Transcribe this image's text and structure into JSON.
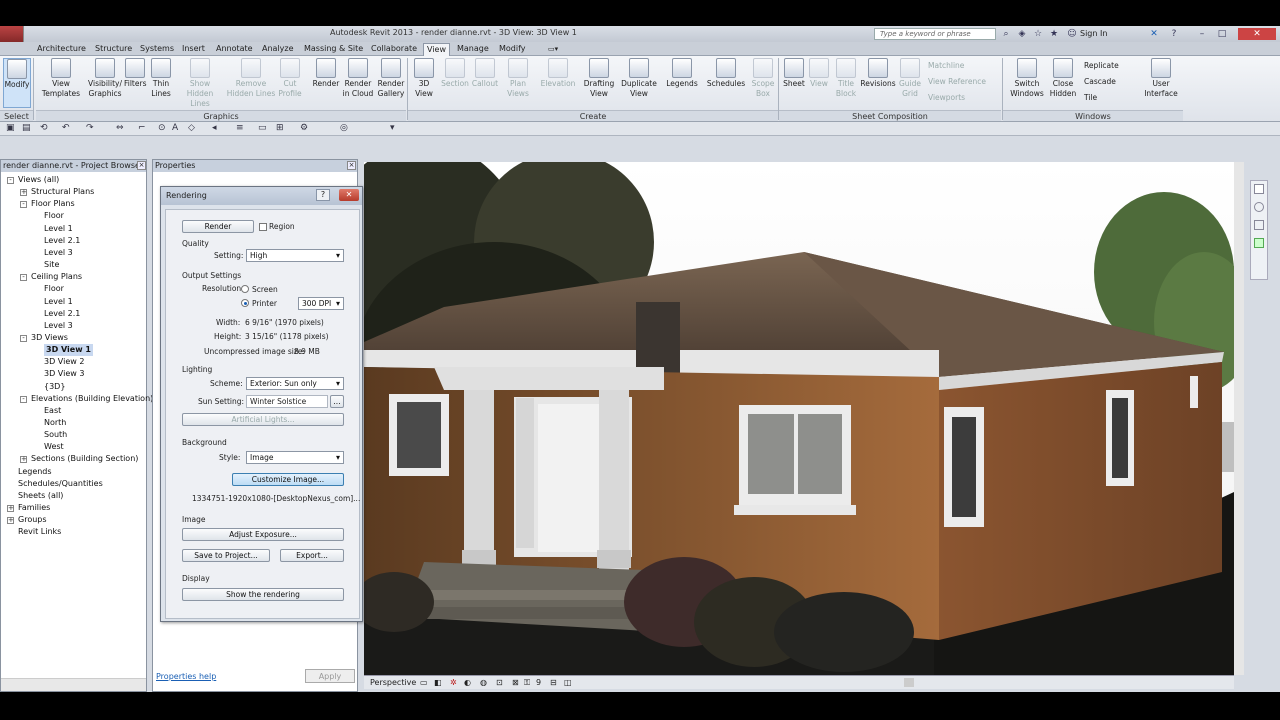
{
  "titlebar": {
    "title": "Autodesk Revit 2013 -     render dianne.rvt - 3D View: 3D View 1",
    "search_placeholder": "Type a keyword or phrase",
    "sign_in": "Sign In"
  },
  "tabs": [
    "Architecture",
    "Structure",
    "Systems",
    "Insert",
    "Annotate",
    "Analyze",
    "Massing & Site",
    "Collaborate",
    "View",
    "Manage",
    "Modify"
  ],
  "active_tab": "View",
  "ribbon": {
    "modify": "Modify",
    "view_templates": "View Templates",
    "visibility_graphics": "Visibility/ Graphics",
    "filters": "Filters",
    "thin_lines": "Thin Lines",
    "show_hidden": "Show Hidden Lines",
    "remove_hidden": "Remove Hidden Lines",
    "cut_profile": "Cut Profile",
    "render": "Render",
    "render_cloud": "Render in Cloud",
    "render_gallery": "Render Gallery",
    "view_3d": "3D View",
    "section": "Section",
    "callout": "Callout",
    "plan_views": "Plan Views",
    "elevation": "Elevation",
    "drafting_view": "Drafting View",
    "duplicate_view": "Duplicate View",
    "legends": "Legends",
    "schedules": "Schedules",
    "scope_box": "Scope Box",
    "sheet": "Sheet",
    "view": "View",
    "title_block": "Title Block",
    "revisions": "Revisions",
    "guide_grid": "Guide Grid",
    "matchline": "Matchline",
    "view_reference": "View Reference",
    "viewports": "Viewports",
    "switch_windows": "Switch Windows",
    "close_hidden": "Close Hidden",
    "replicate": "Replicate",
    "cascade": "Cascade",
    "tile": "Tile",
    "user_interface": "User Interface",
    "panel_select": "Select",
    "panel_graphics": "Graphics",
    "panel_create": "Create",
    "panel_sheet": "Sheet Composition",
    "panel_windows": "Windows"
  },
  "project_browser": {
    "title": "render dianne.rvt - Project Browser",
    "items": [
      {
        "label": "Views (all)",
        "level": 0,
        "exp": "-"
      },
      {
        "label": "Structural Plans",
        "level": 1,
        "exp": "+"
      },
      {
        "label": "Floor Plans",
        "level": 1,
        "exp": "-"
      },
      {
        "label": "Floor",
        "level": 2
      },
      {
        "label": "Level 1",
        "level": 2
      },
      {
        "label": "Level 2.1",
        "level": 2
      },
      {
        "label": "Level 3",
        "level": 2
      },
      {
        "label": "Site",
        "level": 2
      },
      {
        "label": "Ceiling Plans",
        "level": 1,
        "exp": "-"
      },
      {
        "label": "Floor",
        "level": 2
      },
      {
        "label": "Level 1",
        "level": 2
      },
      {
        "label": "Level 2.1",
        "level": 2
      },
      {
        "label": "Level 3",
        "level": 2
      },
      {
        "label": "3D Views",
        "level": 1,
        "exp": "-"
      },
      {
        "label": "3D View 1",
        "level": 2,
        "sel": true
      },
      {
        "label": "3D View 2",
        "level": 2
      },
      {
        "label": "3D View 3",
        "level": 2
      },
      {
        "label": "{3D}",
        "level": 2
      },
      {
        "label": "Elevations (Building Elevation)",
        "level": 1,
        "exp": "-"
      },
      {
        "label": "East",
        "level": 2
      },
      {
        "label": "North",
        "level": 2
      },
      {
        "label": "South",
        "level": 2
      },
      {
        "label": "West",
        "level": 2
      },
      {
        "label": "Sections (Building Section)",
        "level": 1,
        "exp": "+"
      },
      {
        "label": "Legends",
        "level": 0
      },
      {
        "label": "Schedules/Quantities",
        "level": 0
      },
      {
        "label": "Sheets (all)",
        "level": 0
      },
      {
        "label": "Families",
        "level": 0,
        "exp": "+"
      },
      {
        "label": "Groups",
        "level": 0,
        "exp": "+"
      },
      {
        "label": "Revit Links",
        "level": 0
      }
    ]
  },
  "properties": {
    "title": "Properties",
    "help": "Properties help",
    "apply": "Apply"
  },
  "rendering": {
    "title": "Rendering",
    "render_btn": "Render",
    "region": "Region",
    "quality": "Quality",
    "setting_label": "Setting:",
    "setting_value": "High",
    "output_settings": "Output Settings",
    "resolution": "Resolution:",
    "screen": "Screen",
    "printer": "Printer",
    "dpi": "300 DPI",
    "width_label": "Width:",
    "width_value": "6 9/16\" (1970 pixels)",
    "height_label": "Height:",
    "height_value": "3 15/16\" (1178 pixels)",
    "uncompressed_label": "Uncompressed image size:",
    "uncompressed_value": "8.9 MB",
    "lighting": "Lighting",
    "scheme_label": "Scheme:",
    "scheme_value": "Exterior: Sun only",
    "sun_label": "Sun Setting:",
    "sun_value": "Winter Solstice",
    "artificial": "Artificial Lights...",
    "background": "Background",
    "style_label": "Style:",
    "style_value": "Image",
    "customize": "Customize Image...",
    "image_file": "1334751-1920x1080-[DesktopNexus_com]...",
    "image": "Image",
    "adjust": "Adjust Exposure...",
    "save": "Save to Project...",
    "export": "Export...",
    "display": "Display",
    "show": "Show the rendering"
  },
  "viewbar": {
    "perspective": "Perspective",
    "scale": "9"
  }
}
